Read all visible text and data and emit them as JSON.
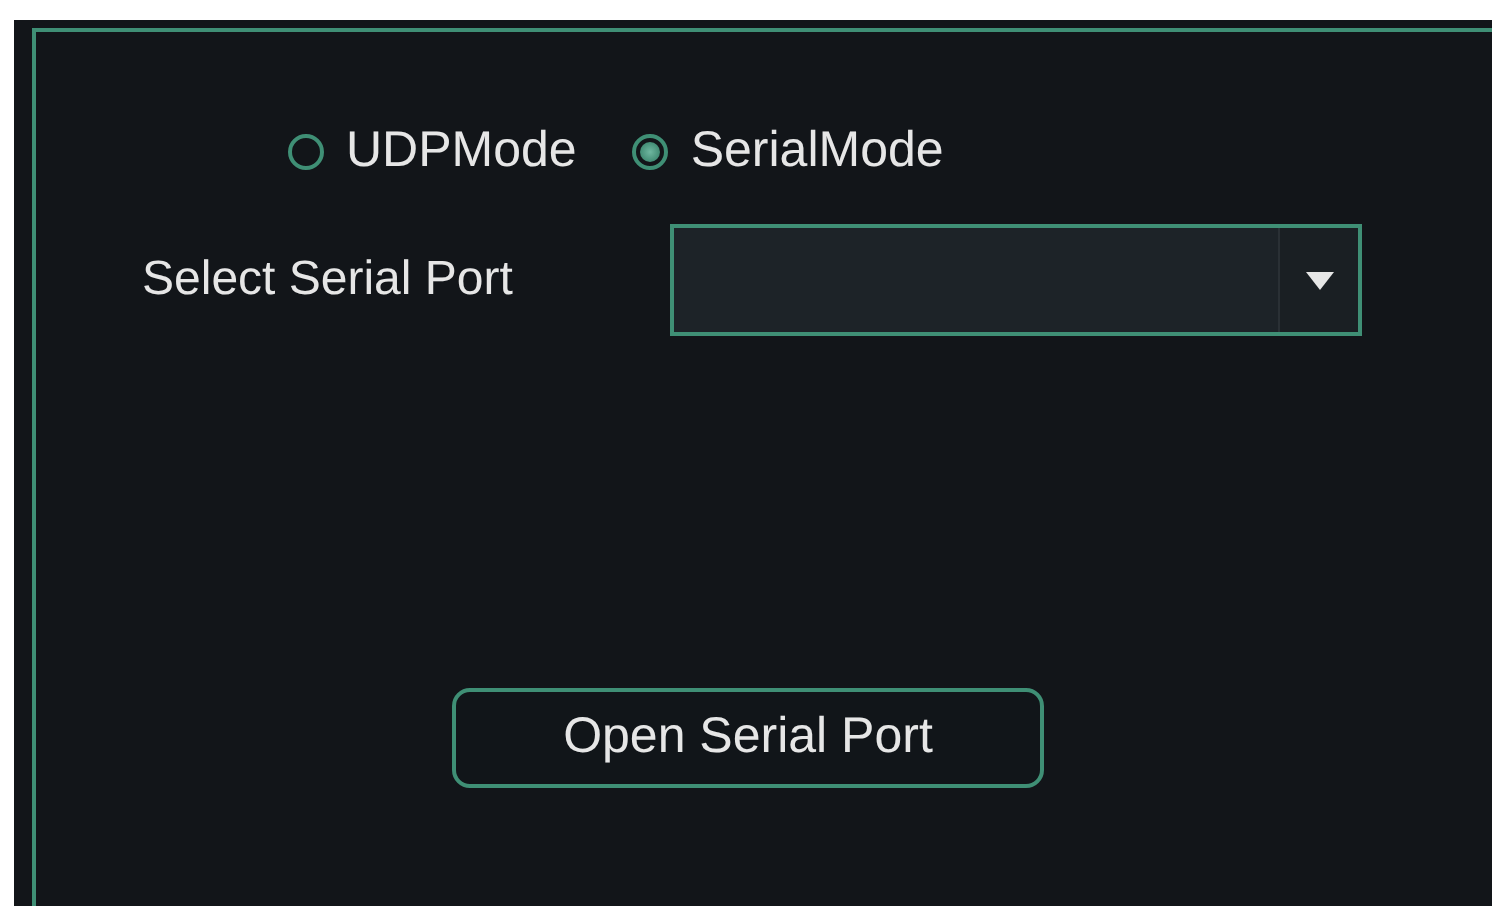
{
  "modes": [
    {
      "label": "UDPMode",
      "selected": false
    },
    {
      "label": "SerialMode",
      "selected": true
    }
  ],
  "serial_port": {
    "label": "Select Serial Port"
  },
  "button": {
    "label": "Open Serial Port"
  }
}
